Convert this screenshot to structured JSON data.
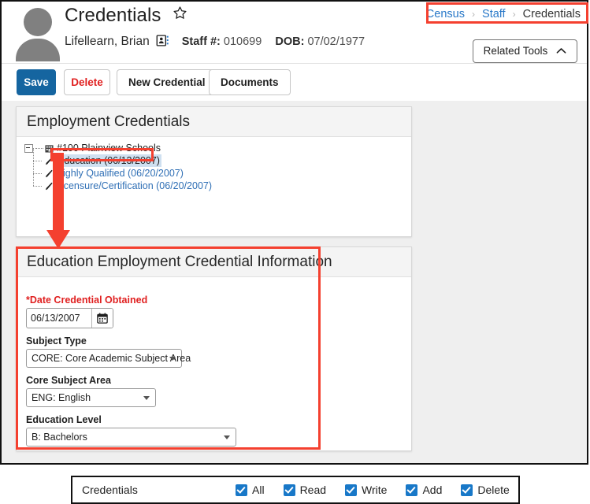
{
  "header": {
    "title": "Credentials",
    "favorite_icon": "star-icon",
    "person_name": "Lifellearn, Brian",
    "contact_icon": "contact-card-icon",
    "staff_label": "Staff #:",
    "staff_number": "010699",
    "dob_label": "DOB:",
    "dob_value": "07/02/1977"
  },
  "breadcrumb": {
    "items": [
      "Census",
      "Staff",
      "Credentials"
    ],
    "separator": "›"
  },
  "related_tools": {
    "label": "Related Tools",
    "chevron": "⌃"
  },
  "toolbar": {
    "save_label": "Save",
    "delete_label": "Delete",
    "new_credential_label": "New Credential",
    "documents_label": "Documents"
  },
  "credentials_panel": {
    "title": "Employment Credentials",
    "tree": {
      "root": "#100 Plainview Schools",
      "children": [
        {
          "label": "Education (06/13/2007)",
          "selected": true
        },
        {
          "label": "Highly Qualified (06/20/2007)",
          "selected": false
        },
        {
          "label": "Licensure/Certification (06/20/2007)",
          "selected": false
        }
      ]
    }
  },
  "info_panel": {
    "title": "Education Employment Credential Information",
    "fields": {
      "date_credential_obtained": {
        "label": "*Date Credential Obtained",
        "value": "06/13/2007",
        "placeholder": "mm/dd/yyyy",
        "calendar_icon": "calendar-icon"
      },
      "subject_type": {
        "label": "Subject Type",
        "value": "CORE: Core Academic Subject Area"
      },
      "core_subject_area": {
        "label": "Core Subject Area",
        "value": "ENG: English"
      },
      "education_level": {
        "label": "Education Level",
        "value": "B: Bachelors"
      }
    }
  },
  "permission_bar": {
    "tool_name": "Credentials",
    "options": [
      {
        "label": "All",
        "checked": true
      },
      {
        "label": "Read",
        "checked": true
      },
      {
        "label": "Write",
        "checked": true
      },
      {
        "label": "Add",
        "checked": true
      },
      {
        "label": "Delete",
        "checked": true
      }
    ]
  },
  "colors": {
    "accent_blue": "#1565a0",
    "link_blue": "#2878c8",
    "tree_link": "#2f6fb5",
    "danger_red": "#e02020",
    "annotation_red": "#f4402f",
    "checkbox_blue": "#1878c8",
    "selected_row": "#cfe0f0"
  }
}
